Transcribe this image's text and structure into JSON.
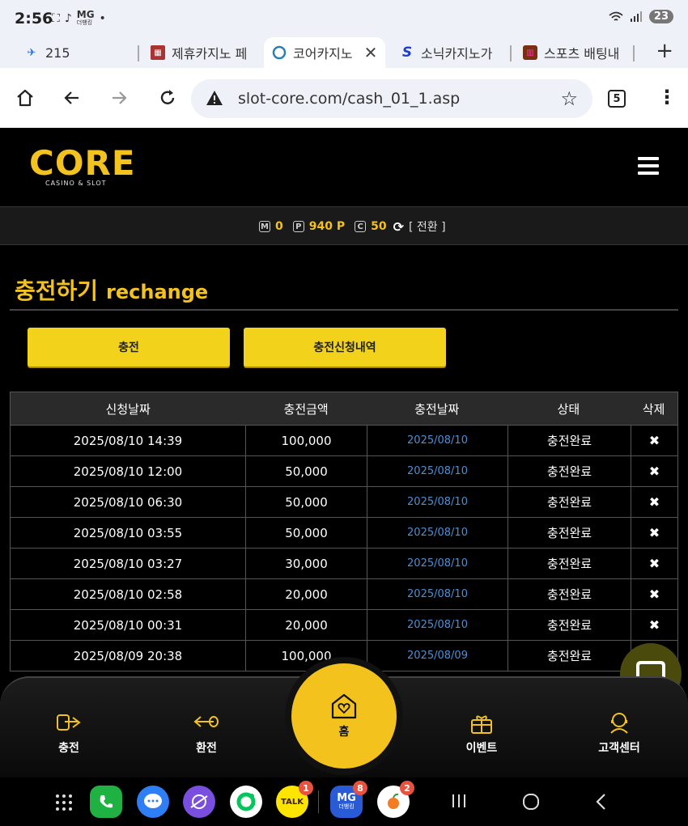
{
  "status_bar": {
    "time": "2:56",
    "mg_label": "MG",
    "mg_sub": "더뱅킹",
    "battery": "23"
  },
  "tabs": [
    {
      "label": "215"
    },
    {
      "label": "제휴카지노 페"
    },
    {
      "label": "코어카지노"
    },
    {
      "label": "소닉카지노가"
    },
    {
      "label": "스포츠 배팅내"
    }
  ],
  "browser": {
    "url": "slot-core.com/cash_01_1.asp",
    "tab_count": "5"
  },
  "logo": {
    "main": "CORE",
    "sub": "CASINO & SLOT"
  },
  "balance": {
    "m_value": "0",
    "p_value": "940 P",
    "c_value": "50",
    "convert_label": "[ 전환 ]"
  },
  "page": {
    "title_ko": "충전하기",
    "title_en": "rechange"
  },
  "buttons": {
    "charge": "충전",
    "history": "충전신청내역"
  },
  "table": {
    "headers": [
      "신청날짜",
      "충전금액",
      "충전날짜",
      "상태",
      "삭제"
    ],
    "rows": [
      {
        "request_date": "2025/08/10 14:39",
        "amount": "100,000",
        "charge_date": "2025/08/10",
        "status": "충전완료",
        "delete": "✖"
      },
      {
        "request_date": "2025/08/10 12:00",
        "amount": "50,000",
        "charge_date": "2025/08/10",
        "status": "충전완료",
        "delete": "✖"
      },
      {
        "request_date": "2025/08/10 06:30",
        "amount": "50,000",
        "charge_date": "2025/08/10",
        "status": "충전완료",
        "delete": "✖"
      },
      {
        "request_date": "2025/08/10 03:55",
        "amount": "50,000",
        "charge_date": "2025/08/10",
        "status": "충전완료",
        "delete": "✖"
      },
      {
        "request_date": "2025/08/10 03:27",
        "amount": "30,000",
        "charge_date": "2025/08/10",
        "status": "충전완료",
        "delete": "✖"
      },
      {
        "request_date": "2025/08/10 02:58",
        "amount": "20,000",
        "charge_date": "2025/08/10",
        "status": "충전완료",
        "delete": "✖"
      },
      {
        "request_date": "2025/08/10 00:31",
        "amount": "20,000",
        "charge_date": "2025/08/10",
        "status": "충전완료",
        "delete": "✖"
      },
      {
        "request_date": "2025/08/09 20:38",
        "amount": "100,000",
        "charge_date": "2025/08/09",
        "status": "충전완료",
        "delete": ""
      }
    ]
  },
  "bottom_nav": {
    "charge": "충전",
    "exchange": "환전",
    "home": "홈",
    "event": "이벤트",
    "support": "고객센터"
  },
  "dock": {
    "kakao_badge": "1",
    "mg_badge": "8",
    "mg_label": "MG",
    "mg_sub": "더뱅킹",
    "orange_badge": "2",
    "kakao_label": "TALK"
  },
  "colors": {
    "accent": "#f3c21c",
    "link": "#4a90d9",
    "background": "#000000"
  }
}
